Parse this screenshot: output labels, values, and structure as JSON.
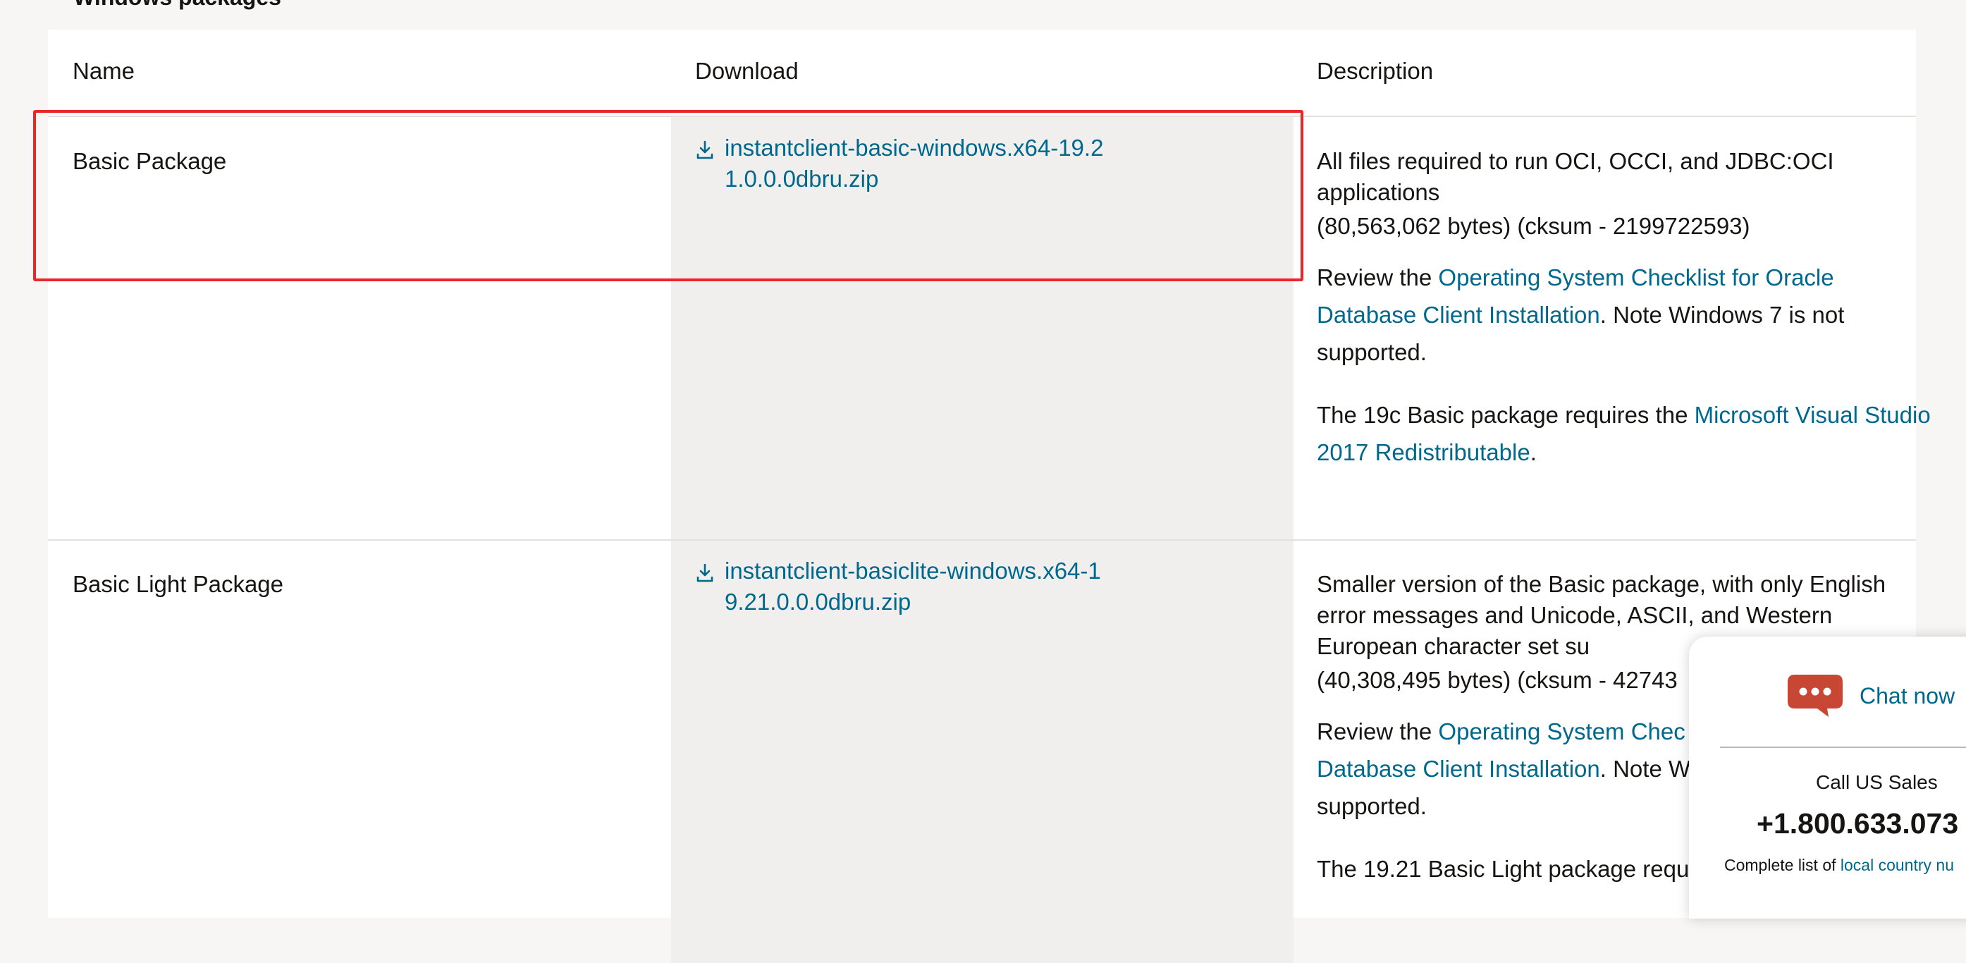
{
  "section_heading_partial": "Windows packages",
  "table": {
    "headers": {
      "name": "Name",
      "download": "Download",
      "description": "Description"
    },
    "rows": [
      {
        "name": "Basic Package",
        "download_file": "instantclient-basic-windows.x64-19.21.0.0.0dbru.zip",
        "summary": "All files required to run OCI, OCCI, and JDBC:OCI applications",
        "size": "(80,563,062 bytes) (cksum - 2199722593)",
        "review_prefix": "Review the ",
        "review_link": "Operating System Checklist for Oracle Database Client Installation",
        "review_suffix": ". Note Windows 7 is not supported.",
        "requires_prefix": "The 19c Basic package requires the ",
        "requires_link": "Microsoft Visual Studio 2017 Redistributable",
        "requires_suffix": "."
      },
      {
        "name": "Basic Light Package",
        "download_file": "instantclient-basiclite-windows.x64-19.21.0.0.0dbru.zip",
        "summary": "Smaller version of the Basic package, with only English error messages and Unicode, ASCII, and Western European character set su",
        "size": "(40,308,495 bytes) (cksum - 42743",
        "review_prefix": "Review the ",
        "review_link": "Operating System Chec",
        "review_link_line2": "Database Client Installation",
        "review_suffix": ". Note W",
        "review_line3": "supported.",
        "requires_partial": "The 19.21 Basic Light package requ"
      }
    ]
  },
  "chat_widget": {
    "chat_label": "Chat now",
    "sales_label": "Call US Sales",
    "phone": "+1.800.633.073",
    "country_prefix": "Complete list of ",
    "country_link": "local country nu"
  },
  "colors": {
    "link": "#00688c",
    "highlight_border": "#e8272a",
    "chat_icon": "#c74634",
    "download_column_bg": "#f0efed"
  },
  "icons": {
    "download": "download-icon",
    "chat": "chat-bubble-icon"
  }
}
